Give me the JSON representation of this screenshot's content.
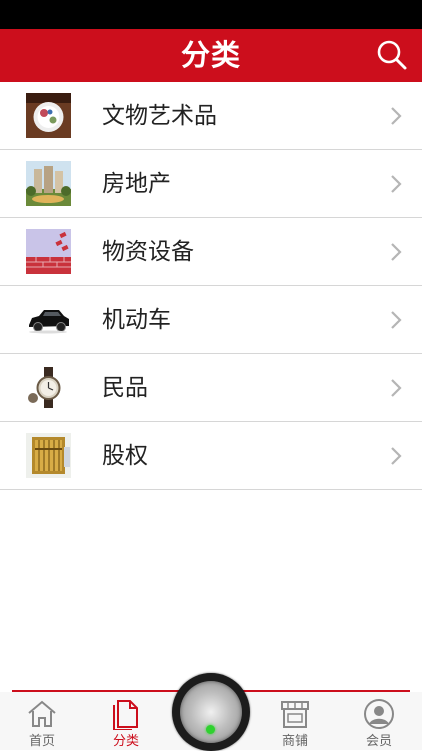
{
  "header": {
    "title": "分类",
    "search_icon": "search-icon"
  },
  "categories": [
    {
      "label": "文物艺术品",
      "icon": "antique-vase-thumbnail"
    },
    {
      "label": "房地产",
      "icon": "real-estate-thumbnail"
    },
    {
      "label": "物资设备",
      "icon": "materials-equipment-thumbnail"
    },
    {
      "label": "机动车",
      "icon": "car-thumbnail"
    },
    {
      "label": "民品",
      "icon": "watch-thumbnail"
    },
    {
      "label": "股权",
      "icon": "abacus-thumbnail"
    }
  ],
  "tabbar": {
    "tabs": [
      {
        "label": "首页",
        "icon": "home-icon",
        "active": false
      },
      {
        "label": "分类",
        "icon": "category-icon",
        "active": true
      },
      {
        "label": "商铺",
        "icon": "shop-icon",
        "active": false
      },
      {
        "label": "会员",
        "icon": "member-icon",
        "active": false
      }
    ],
    "center_button": "center-knob-button"
  },
  "colors": {
    "brand_red": "#cc0e1c",
    "status_bar": "#000000",
    "divider": "#d6d6d6",
    "text": "#222222",
    "chevron": "#b5b5b5"
  }
}
